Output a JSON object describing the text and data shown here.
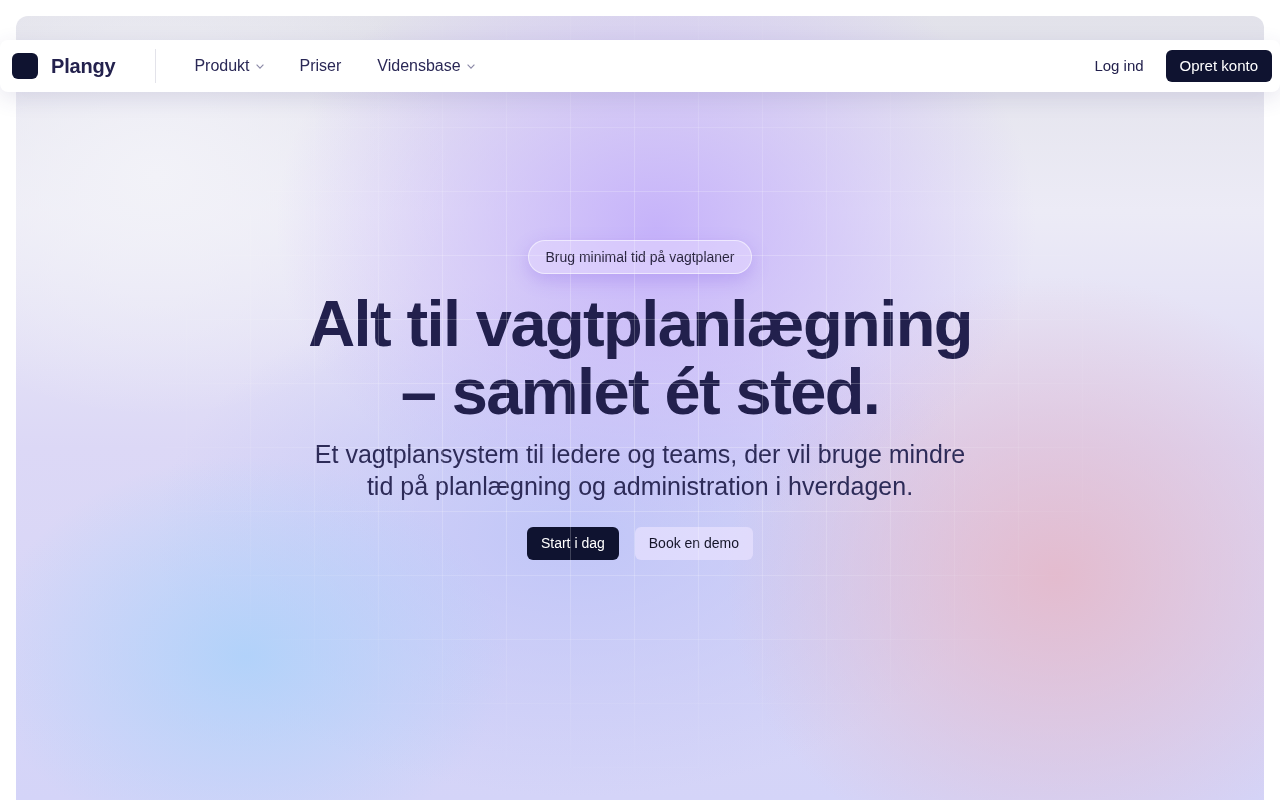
{
  "navbar": {
    "brand": "Plangy",
    "links": [
      {
        "label": "Produkt",
        "dropdown": true
      },
      {
        "label": "Priser",
        "dropdown": false
      },
      {
        "label": "Vidensbase",
        "dropdown": true
      }
    ],
    "login": "Log ind",
    "signup": "Opret konto"
  },
  "hero": {
    "badge": "Brug minimal tid på vagtplaner",
    "heading": "Alt til vagtplanlægning – samlet ét sted.",
    "subheading": "Et vagtplansystem til ledere og teams, der vil bruge mindre tid på planlægning og administration i hverdagen.",
    "buttons": [
      {
        "label": "Start i dag",
        "kind": "primary"
      },
      {
        "label": "Book en demo",
        "kind": "secondary"
      }
    ]
  }
}
